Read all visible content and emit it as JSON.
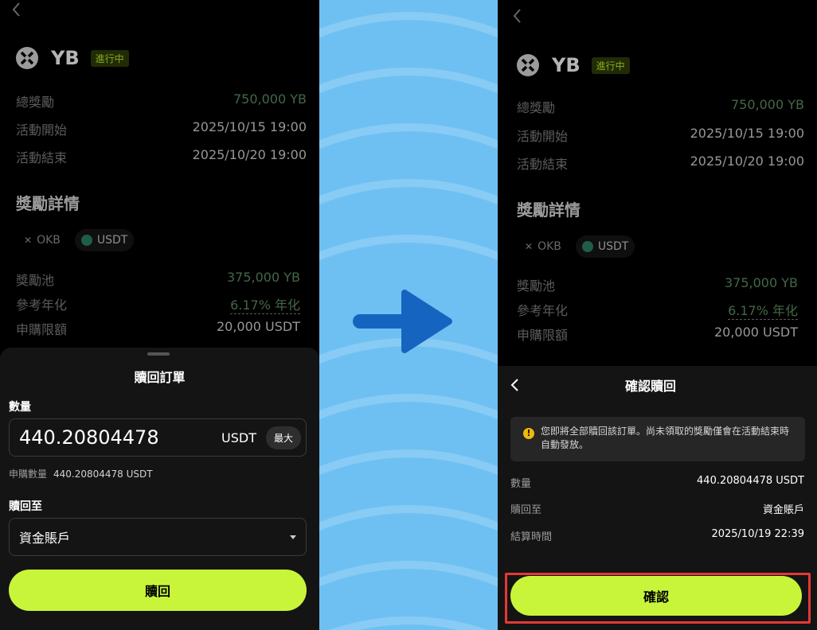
{
  "token": {
    "name": "YB",
    "status": "進行中"
  },
  "campaign": {
    "rows": [
      {
        "label": "總獎勵",
        "value": "750,000 YB"
      },
      {
        "label": "活動開始",
        "value": "2025/10/15 19:00"
      },
      {
        "label": "活動結束",
        "value": "2025/10/20 19:00"
      }
    ]
  },
  "rewards": {
    "title": "獎勵詳情",
    "chips": [
      "OKB",
      "USDT"
    ],
    "rows": [
      {
        "label": "獎勵池",
        "value": "375,000 YB"
      },
      {
        "label": "參考年化",
        "value": "6.17% 年化"
      },
      {
        "label": "申購限額",
        "value": "20,000 USDT"
      }
    ]
  },
  "redeem_sheet": {
    "title": "贖回訂單",
    "amount_label": "數量",
    "amount_value": "440.20804478",
    "amount_unit": "USDT",
    "max_label": "最大",
    "subscribed_label": "申購數量",
    "subscribed_value": "440.20804478 USDT",
    "redeem_to_label": "贖回至",
    "redeem_to_value": "資金賬戶",
    "redeem_button": "贖回"
  },
  "confirm_sheet": {
    "title": "確認贖回",
    "notice": "您即將全部贖回該訂單。尚未領取的獎勵僅會在活動結束時自動發放。",
    "rows": [
      {
        "label": "數量",
        "value": "440.20804478 USDT"
      },
      {
        "label": "贖回至",
        "value": "資金賬戶"
      },
      {
        "label": "結算時間",
        "value": "2025/10/19 22:39"
      }
    ],
    "confirm_button": "確認"
  },
  "colors": {
    "accent_green": "#c8f53a",
    "divider_blue": "#6fc0f2",
    "arrow_blue": "#1565c0",
    "highlight_red": "#e53935"
  },
  "icons": [
    "chevron-left-icon",
    "yb-logo-icon",
    "okb-icon",
    "usdt-icon",
    "caret-down-icon",
    "warning-icon",
    "arrow-right-icon"
  ]
}
